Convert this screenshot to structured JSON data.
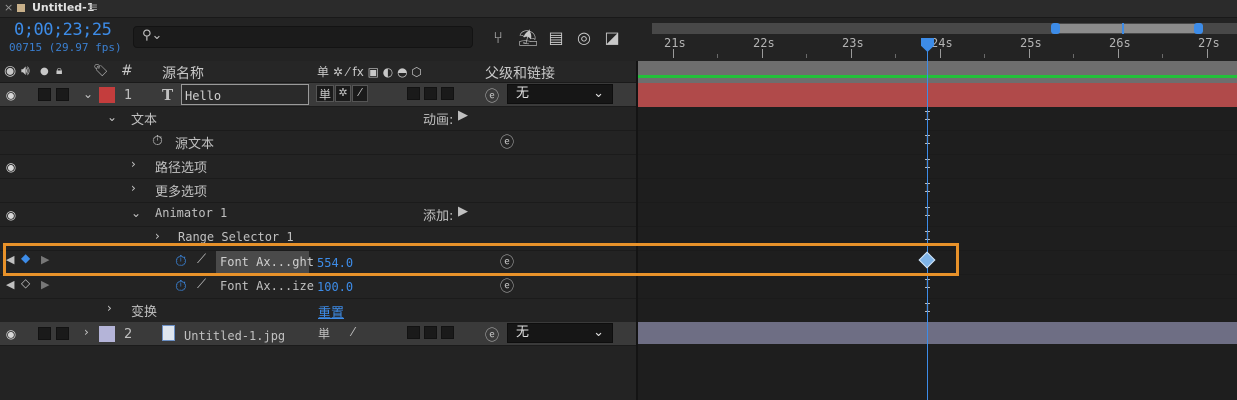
{
  "tab": {
    "close_label": "×",
    "title": "Untitled-1",
    "menu_glyph": "≡"
  },
  "time": {
    "timecode": "0;00;23;25",
    "frames": "00715 (29.97 fps)"
  },
  "search": {
    "placeholder": "",
    "icon": "search-icon"
  },
  "ruler": {
    "labels": [
      "21s",
      "22s",
      "23s",
      "24s",
      "25s",
      "26s",
      "27s"
    ]
  },
  "columns": {
    "hash": "#",
    "source_name": "源名称",
    "switches": "单 ✲ ⁄ fx ▣ ◐ ◓ ⬡",
    "parent": "父级和链接"
  },
  "layer1": {
    "number": "1",
    "type_glyph": "T",
    "name": "Hello",
    "parent_value": "无",
    "label_color": "#c43d3d"
  },
  "text_group": {
    "label": "文本",
    "animate_label": "动画:"
  },
  "source_text": {
    "label": "源文本"
  },
  "path_options": {
    "label": "路径选项"
  },
  "more_options": {
    "label": "更多选项"
  },
  "animator": {
    "label": "Animator 1",
    "add_label": "添加:"
  },
  "range_selector": {
    "label": "Range Selector 1"
  },
  "prop_weight": {
    "label": "Font Ax...ght",
    "value": "554.0"
  },
  "prop_size": {
    "label": "Font Ax...ize",
    "value": "100.0"
  },
  "transform": {
    "label": "变换",
    "reset_label": "重置"
  },
  "layer2": {
    "number": "2",
    "name": "Untitled-1.jpg",
    "parent_value": "无",
    "label_color": "#b4b4d8"
  },
  "colors": {
    "accent": "#3d8ce8",
    "highlight": "#e8922a",
    "layer1_bar": "#b04a4a",
    "layer2_bar": "#6e6e84",
    "work_green": "#22c03a"
  }
}
